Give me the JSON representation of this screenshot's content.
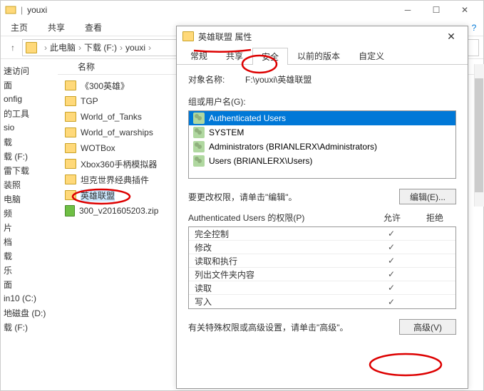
{
  "explorer": {
    "title": "youxi",
    "menu": [
      "主页",
      "共享",
      "查看"
    ],
    "breadcrumb": [
      "此电脑",
      "下载 (F:)",
      "youxi"
    ],
    "nav_items": [
      "速访问",
      "面",
      "onfig",
      "的工具",
      "sio",
      "载",
      "载 (F:)",
      "雷下载",
      "装照",
      "电脑",
      "频",
      "片",
      "档",
      "载",
      "乐",
      "面",
      "in10 (C:)",
      "地磁盘 (D:)",
      "载 (F:)"
    ],
    "column_header": "名称",
    "files": [
      {
        "name": "《300英雄》",
        "type": "folder"
      },
      {
        "name": "TGP",
        "type": "folder"
      },
      {
        "name": "World_of_Tanks",
        "type": "folder"
      },
      {
        "name": "World_of_warships",
        "type": "folder"
      },
      {
        "name": "WOTBox",
        "type": "folder"
      },
      {
        "name": "Xbox360手柄模拟器",
        "type": "folder"
      },
      {
        "name": "坦克世界经典插件",
        "type": "folder"
      },
      {
        "name": "英雄联盟",
        "type": "folder",
        "selected": true
      },
      {
        "name": "300_v201605203.zip",
        "type": "zip"
      }
    ]
  },
  "dialog": {
    "title": "英雄联盟 属性",
    "tabs": [
      "常规",
      "共享",
      "安全",
      "以前的版本",
      "自定义"
    ],
    "active_tab": 2,
    "object_label": "对象名称:",
    "object_value": "F:\\youxi\\英雄联盟",
    "groups_label": "组或用户名(G):",
    "groups": [
      {
        "name": "Authenticated Users",
        "selected": true
      },
      {
        "name": "SYSTEM"
      },
      {
        "name": "Administrators (BRIANLERX\\Administrators)"
      },
      {
        "name": "Users (BRIANLERX\\Users)"
      }
    ],
    "edit_text": "要更改权限，请单击\"编辑\"。",
    "edit_btn": "编辑(E)...",
    "perms_label": "Authenticated Users 的权限(P)",
    "col_allow": "允许",
    "col_deny": "拒绝",
    "perms": [
      {
        "name": "完全控制",
        "allow": "dark"
      },
      {
        "name": "修改",
        "allow": "gray"
      },
      {
        "name": "读取和执行",
        "allow": "gray"
      },
      {
        "name": "列出文件夹内容",
        "allow": "gray"
      },
      {
        "name": "读取",
        "allow": "gray"
      },
      {
        "name": "写入",
        "allow": "gray"
      }
    ],
    "adv_text": "有关特殊权限或高级设置，请单击\"高级\"。",
    "adv_btn": "高级(V)"
  }
}
